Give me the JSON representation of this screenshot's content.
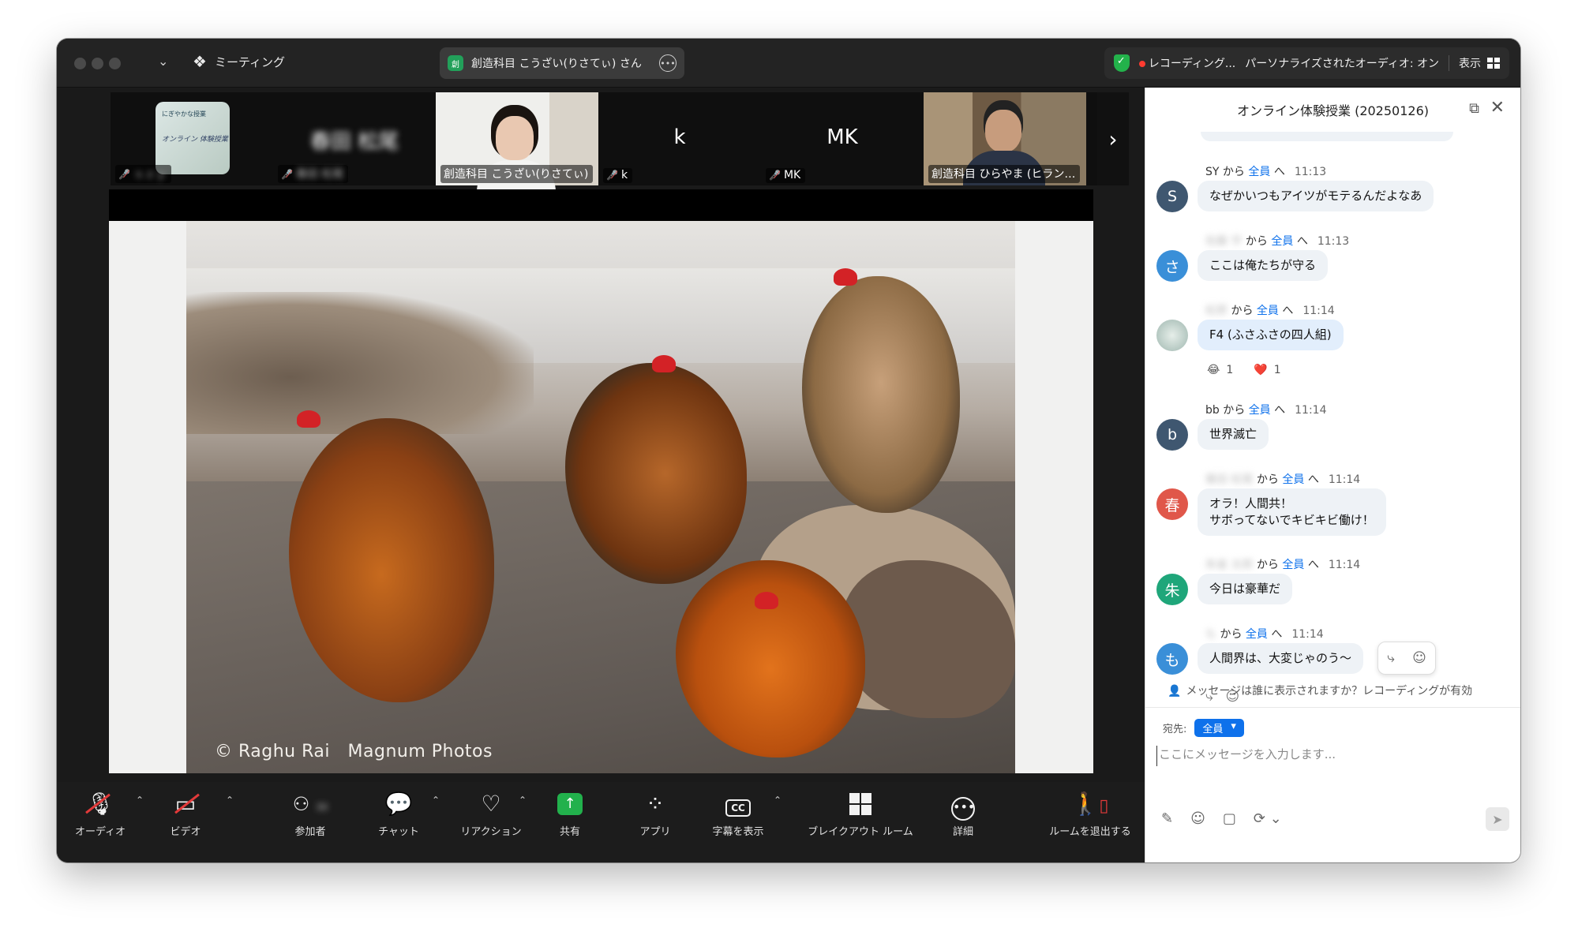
{
  "titlebar": {
    "meeting_label": "ミーティング",
    "active_speaker": "創造科目 こうざい(りさてぃ) さん",
    "speaker_badge": "創",
    "recording": "レコーディング...",
    "audio_status": "パーソナライズされたオーディオ: オン",
    "view_label": "表示"
  },
  "gallery": {
    "tiles": [
      {
        "name": "ｓｚｙ",
        "blurred": true,
        "slide_title": "にぎやかな授業",
        "slide_sub": "オンライン 体験授業"
      },
      {
        "name": "春田 松尾",
        "blurred": true,
        "big": "春田 松尾"
      },
      {
        "name": "創造科目 こうざい(りさてぃ)"
      },
      {
        "name": "k",
        "big": "k"
      },
      {
        "name": "MK",
        "big": "MK"
      },
      {
        "name": "創造科目 ひらやま (ヒラン…"
      }
    ]
  },
  "shared_content": {
    "credit": "© Raghu Rai　Magnum Photos"
  },
  "toolbar": {
    "audio": "オーディオ",
    "video": "ビデオ",
    "participants": "参加者",
    "participants_count": "30",
    "chat": "チャット",
    "reactions": "リアクション",
    "share": "共有",
    "apps": "アプリ",
    "captions": "字幕を表示",
    "breakout": "ブレイクアウト ルーム",
    "more": "詳細",
    "leave": "ルームを退出する"
  },
  "chat": {
    "title": "オンライン体験授業 (20250126)",
    "from": "から",
    "to_all": "全員",
    "to_suffix": "へ",
    "messages": [
      {
        "sender": "SY",
        "time": "11:13",
        "text": "なぜかいつもアイツがモテるんだよなあ",
        "avatar": "S",
        "color": "#3f5770"
      },
      {
        "sender": "佐藤 宇",
        "time": "11:13",
        "text": "ここは俺たちが守る",
        "avatar": "さ",
        "color": "#3a8fd8"
      },
      {
        "sender": "松原",
        "time": "11:14",
        "text": "F4 (ふさふさの四人組)",
        "avatar": "",
        "color": "#9fb7b0",
        "react1": "1",
        "react2": "1"
      },
      {
        "sender": "bb",
        "time": "11:14",
        "text": "世界滅亡",
        "avatar": "b",
        "color": "#3f5770"
      },
      {
        "sender": "春田 松尾",
        "time": "11:14",
        "text": "オラ！人間共！\nサボってないでキビキビ働け！",
        "avatar": "春",
        "color": "#e0574a"
      },
      {
        "sender": "朱雀 太郎",
        "time": "11:14",
        "text": "今日は豪華だ",
        "avatar": "朱",
        "color": "#1fa67a"
      },
      {
        "sender": "も",
        "time": "11:14",
        "text": "人間界は、大変じゃのう〜",
        "avatar": "も",
        "color": "#3a8fd8"
      }
    ],
    "who_sees": "メッセージは誰に表示されますか？レコーディングが有効",
    "to_label": "宛先:",
    "to_value": "全員",
    "placeholder": "ここにメッセージを入力します..."
  }
}
